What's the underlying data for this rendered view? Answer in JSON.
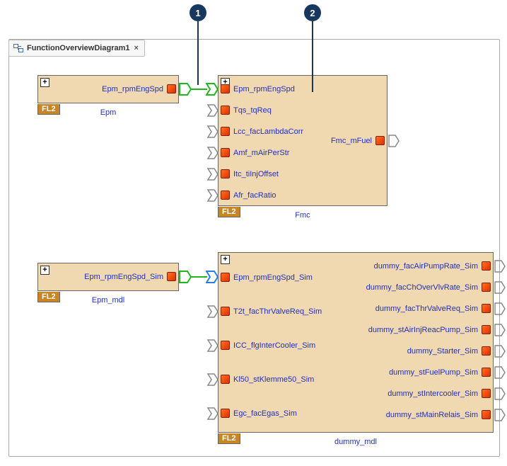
{
  "tab": {
    "title": "FunctionOverviewDiagram1"
  },
  "callouts": {
    "pin1": "1",
    "pin2": "2"
  },
  "tag": "FL2",
  "blocks": {
    "epm": {
      "name": "Epm",
      "outputs": [
        "Epm_rpmEngSpd"
      ]
    },
    "fmc": {
      "name": "Fmc",
      "inputs": [
        "Epm_rpmEngSpd",
        "Tqs_tqReq",
        "Lcc_facLambdaCorr",
        "Amf_mAirPerStr",
        "Itc_tiInjOffset",
        "Afr_facRatio"
      ],
      "outputs": [
        "Fmc_mFuel"
      ]
    },
    "epm_mdl": {
      "name": "Epm_mdl",
      "outputs": [
        "Epm_rpmEngSpd_Sim"
      ]
    },
    "dummy_mdl": {
      "name": "dummy_mdl",
      "inputs": [
        "Epm_rpmEngSpd_Sim",
        "T2t_facThrValveReq_Sim",
        "ICC_flgInterCooler_Sim",
        "Kl50_stKlemme50_Sim",
        "Egc_facEgas_Sim"
      ],
      "outputs": [
        "dummy_facAirPumpRate_Sim",
        "dummy_facChOverVlvRate_Sim",
        "dummy_facThrValveReq_Sim",
        "dummy_stAirInjReacPump_Sim",
        "dummy_Starter_Sim",
        "dummy_stFuelPump_Sim",
        "dummy_stIntercooler_Sim",
        "dummy_stMainRelais_Sim"
      ]
    }
  }
}
